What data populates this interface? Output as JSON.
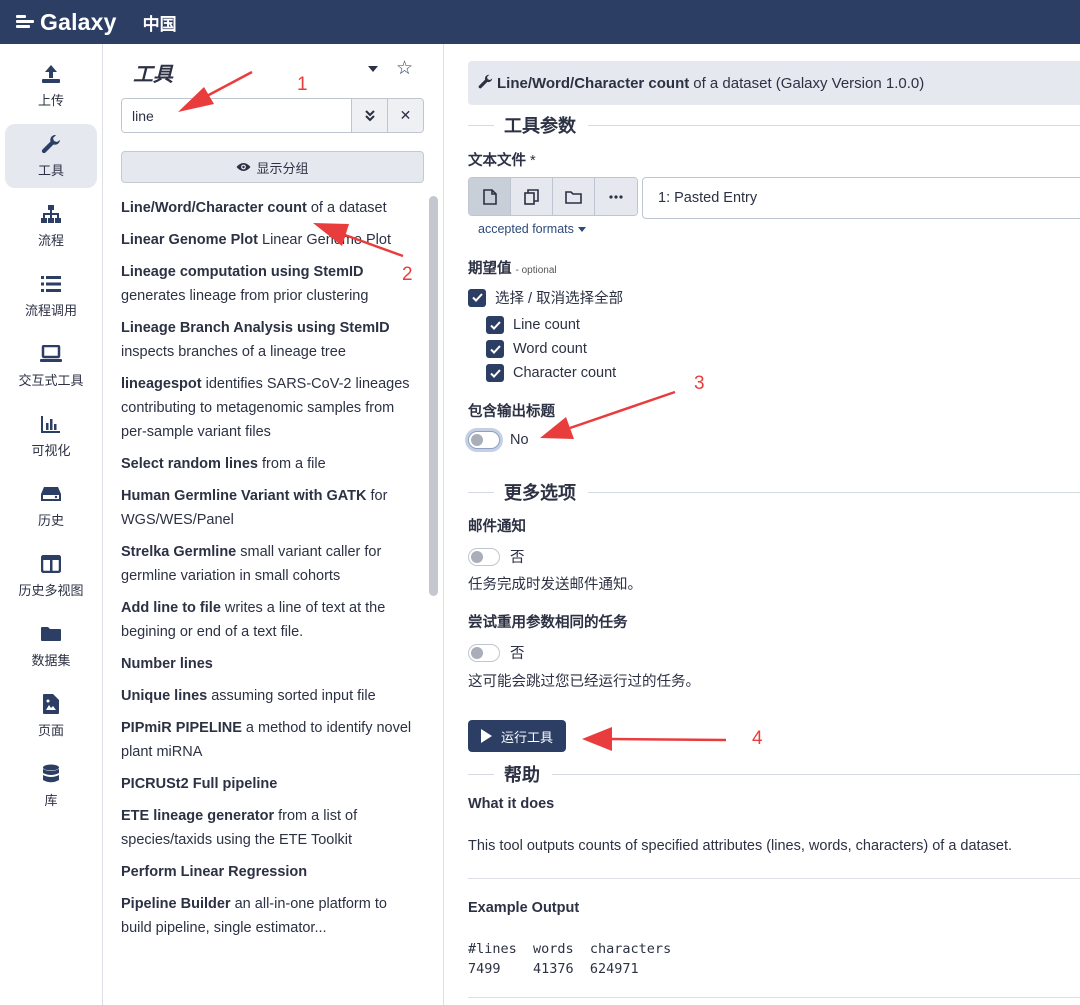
{
  "topbar": {
    "brand": "Galaxy",
    "locale": "中国"
  },
  "activity": [
    {
      "label": "上传",
      "icon": "upload-icon"
    },
    {
      "label": "工具",
      "icon": "wrench-icon",
      "active": true
    },
    {
      "label": "流程",
      "icon": "sitemap-icon"
    },
    {
      "label": "流程调用",
      "icon": "list-icon"
    },
    {
      "label": "交互式工具",
      "icon": "laptop-icon"
    },
    {
      "label": "可视化",
      "icon": "chart-icon"
    },
    {
      "label": "历史",
      "icon": "hdd-icon"
    },
    {
      "label": "历史多视图",
      "icon": "columns-icon"
    },
    {
      "label": "数据集",
      "icon": "folder-icon"
    },
    {
      "label": "页面",
      "icon": "file-image-icon"
    },
    {
      "label": "库",
      "icon": "database-icon"
    }
  ],
  "toolpanel": {
    "title": "工具",
    "search_value": "line",
    "group_label": "显示分组",
    "tools": [
      {
        "name": "Line/Word/Character count",
        "desc": " of a dataset"
      },
      {
        "name": "Linear Genome Plot",
        "desc": " Linear Genome Plot"
      },
      {
        "name": "Lineage computation using StemID",
        "desc": " generates lineage from prior clustering"
      },
      {
        "name": "Lineage Branch Analysis using StemID",
        "desc": " inspects branches of a lineage tree"
      },
      {
        "name": "lineagespot",
        "desc": " identifies SARS-CoV-2 lineages contributing to metagenomic samples from per-sample variant files"
      },
      {
        "name": "Select random lines",
        "desc": " from a file"
      },
      {
        "name": "Human Germline Variant with GATK",
        "desc": " for WGS/WES/Panel"
      },
      {
        "name": "Strelka Germline",
        "desc": " small variant caller for germline variation in small cohorts"
      },
      {
        "name": "Add line to file",
        "desc": " writes a line of text at the begining or end of a text file."
      },
      {
        "name": "Number lines",
        "desc": ""
      },
      {
        "name": "Unique lines",
        "desc": " assuming sorted input file"
      },
      {
        "name": "PIPmiR PIPELINE",
        "desc": " a method to identify novel plant miRNA"
      },
      {
        "name": "PICRUSt2 Full pipeline",
        "desc": ""
      },
      {
        "name": "ETE lineage generator",
        "desc": " from a list of species/taxids using the ETE Toolkit"
      },
      {
        "name": "Perform Linear Regression",
        "desc": ""
      },
      {
        "name": "Pipeline Builder",
        "desc": " an all-in-one platform to build pipeline, single estimator..."
      }
    ]
  },
  "form": {
    "header_tool": "Line/Word/Character count",
    "header_desc": "of a dataset (Galaxy Version 1.0.0)",
    "section_params": "工具参数",
    "input_label": "文本文件",
    "input_required": "*",
    "input_value": "1: Pasted Entry",
    "accepted_formats": "accepted formats",
    "options_label": "期望值",
    "options_optional": "- optional",
    "select_all": "选择 / 取消选择全部",
    "options": [
      "Line count",
      "Word count",
      "Character count"
    ],
    "header_toggle_label": "包含输出标题",
    "header_toggle_value": "No",
    "section_more": "更多选项",
    "email_label": "邮件通知",
    "email_value": "否",
    "email_help": "任务完成时发送邮件通知。",
    "reuse_label": "尝试重用参数相同的任务",
    "reuse_value": "否",
    "reuse_help": "这可能会跳过您已经运行过的任务。",
    "run_label": "运行工具",
    "section_help": "帮助",
    "what_title": "What it does",
    "what_text": "This tool outputs counts of specified attributes (lines, words, characters) of a dataset.",
    "example_title": "Example Output",
    "example_header": "#lines  words  characters",
    "example_values": "7499    41376  624971"
  },
  "annotations": {
    "n1": "1",
    "n2": "2",
    "n3": "3",
    "n4": "4",
    "color": "#e93d3d"
  },
  "colors": {
    "navbar": "#2c3e63",
    "accent": "#2c3e63",
    "panel_bg": "#e5e8ef"
  }
}
